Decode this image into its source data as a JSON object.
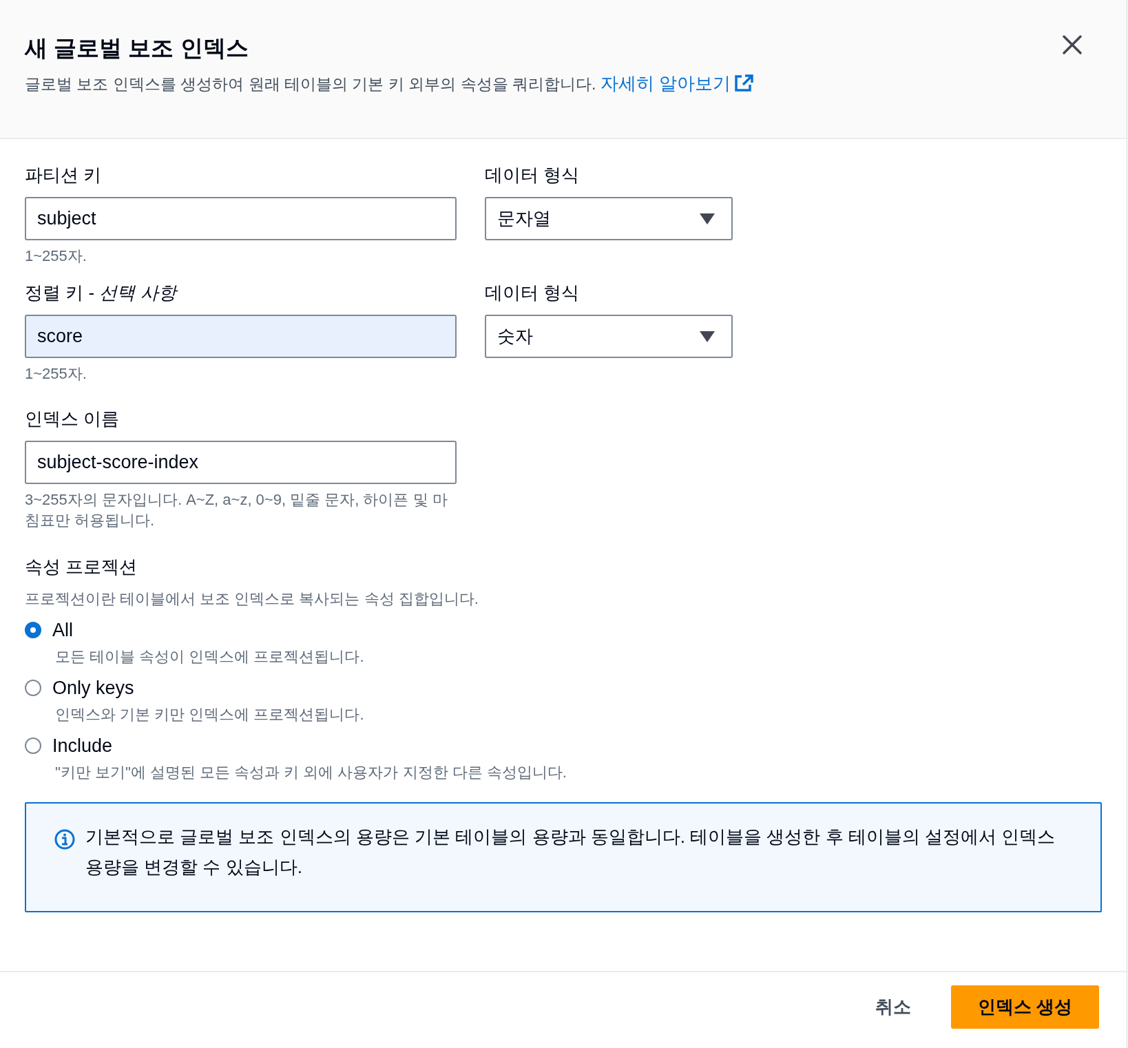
{
  "header": {
    "title": "새 글로벌 보조 인덱스",
    "description": "글로벌 보조 인덱스를 생성하여 원래 테이블의 기본 키 외부의 속성을 쿼리합니다.",
    "link": "자세히 알아보기"
  },
  "key_rows": [
    {
      "key": {
        "label": "파티션 키",
        "value": "subject",
        "autofilled": false,
        "helper": "1~255자."
      },
      "type": {
        "label": "데이터 형식",
        "value": "문자열"
      }
    },
    {
      "key": {
        "label": "정렬 키 - *선택 사항*",
        "value": "score",
        "autofilled": true,
        "helper": "1~255자."
      },
      "type": {
        "label": "데이터 형식",
        "value": "숫자"
      }
    }
  ],
  "index_name": {
    "label": "인덱스 이름",
    "value": "subject-score-index",
    "helper": "3~255자의 문자입니다. A~Z, a~z, 0~9, 밑줄 문자, 하이픈 및 마침표만 허용됩니다."
  },
  "projection": {
    "label": "속성 프로젝션",
    "description": "프로젝션이란 테이블에서 보조 인덱스로 복사되는 속성 집합입니다.",
    "options": [
      {
        "label": "All",
        "description": "모든 테이블 속성이 인덱스에 프로젝션됩니다.",
        "selected": true
      },
      {
        "label": "Only keys",
        "description": "인덱스와 기본 키만 인덱스에 프로젝션됩니다.",
        "selected": false
      },
      {
        "label": "Include",
        "description": "\"키만 보기\"에 설명된 모든 속성과 키 외에 사용자가 지정한 다른 속성입니다.",
        "selected": false
      }
    ]
  },
  "info": {
    "text": "기본적으로 글로벌 보조 인덱스의 용량은 기본 테이블의 용량과 동일합니다. 테이블을 생성한 후 테이블의 설정에서 인덱스 용량을 변경할 수 있습니다."
  },
  "footer": {
    "buttons": [
      {
        "label": "취소",
        "kind": "link"
      },
      {
        "label": "인덱스 생성",
        "kind": "primary"
      }
    ]
  }
}
